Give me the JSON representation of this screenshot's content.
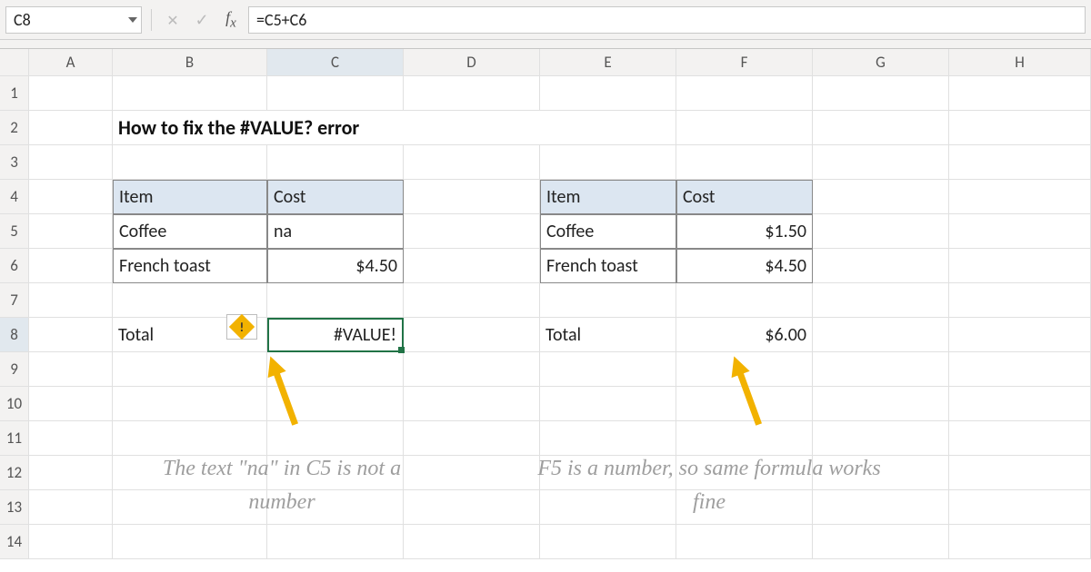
{
  "formulaBar": {
    "nameBox": "C8",
    "formula": "=C5+C6"
  },
  "columns": [
    "A",
    "B",
    "C",
    "D",
    "E",
    "F",
    "G",
    "H"
  ],
  "rows": [
    "1",
    "2",
    "3",
    "4",
    "5",
    "6",
    "7",
    "8",
    "9",
    "10",
    "11",
    "12",
    "13",
    "14"
  ],
  "sheet": {
    "title": "How to fix the #VALUE? error",
    "leftTable": {
      "headers": {
        "item": "Item",
        "cost": "Cost"
      },
      "rows": [
        {
          "item": "Coffee",
          "cost": "na"
        },
        {
          "item": "French toast",
          "cost": "$4.50"
        }
      ],
      "totalLabel": "Total",
      "totalValue": "#VALUE!"
    },
    "rightTable": {
      "headers": {
        "item": "Item",
        "cost": "Cost"
      },
      "rows": [
        {
          "item": "Coffee",
          "cost": "$1.50"
        },
        {
          "item": "French toast",
          "cost": "$4.50"
        }
      ],
      "totalLabel": "Total",
      "totalValue": "$6.00"
    },
    "annotationLeft": "The text \"na\" in C5 is not a number",
    "annotationRight": "F5 is a number, so same formula works fine"
  },
  "selection": {
    "cell": "C8",
    "row": 8,
    "col": "C"
  }
}
